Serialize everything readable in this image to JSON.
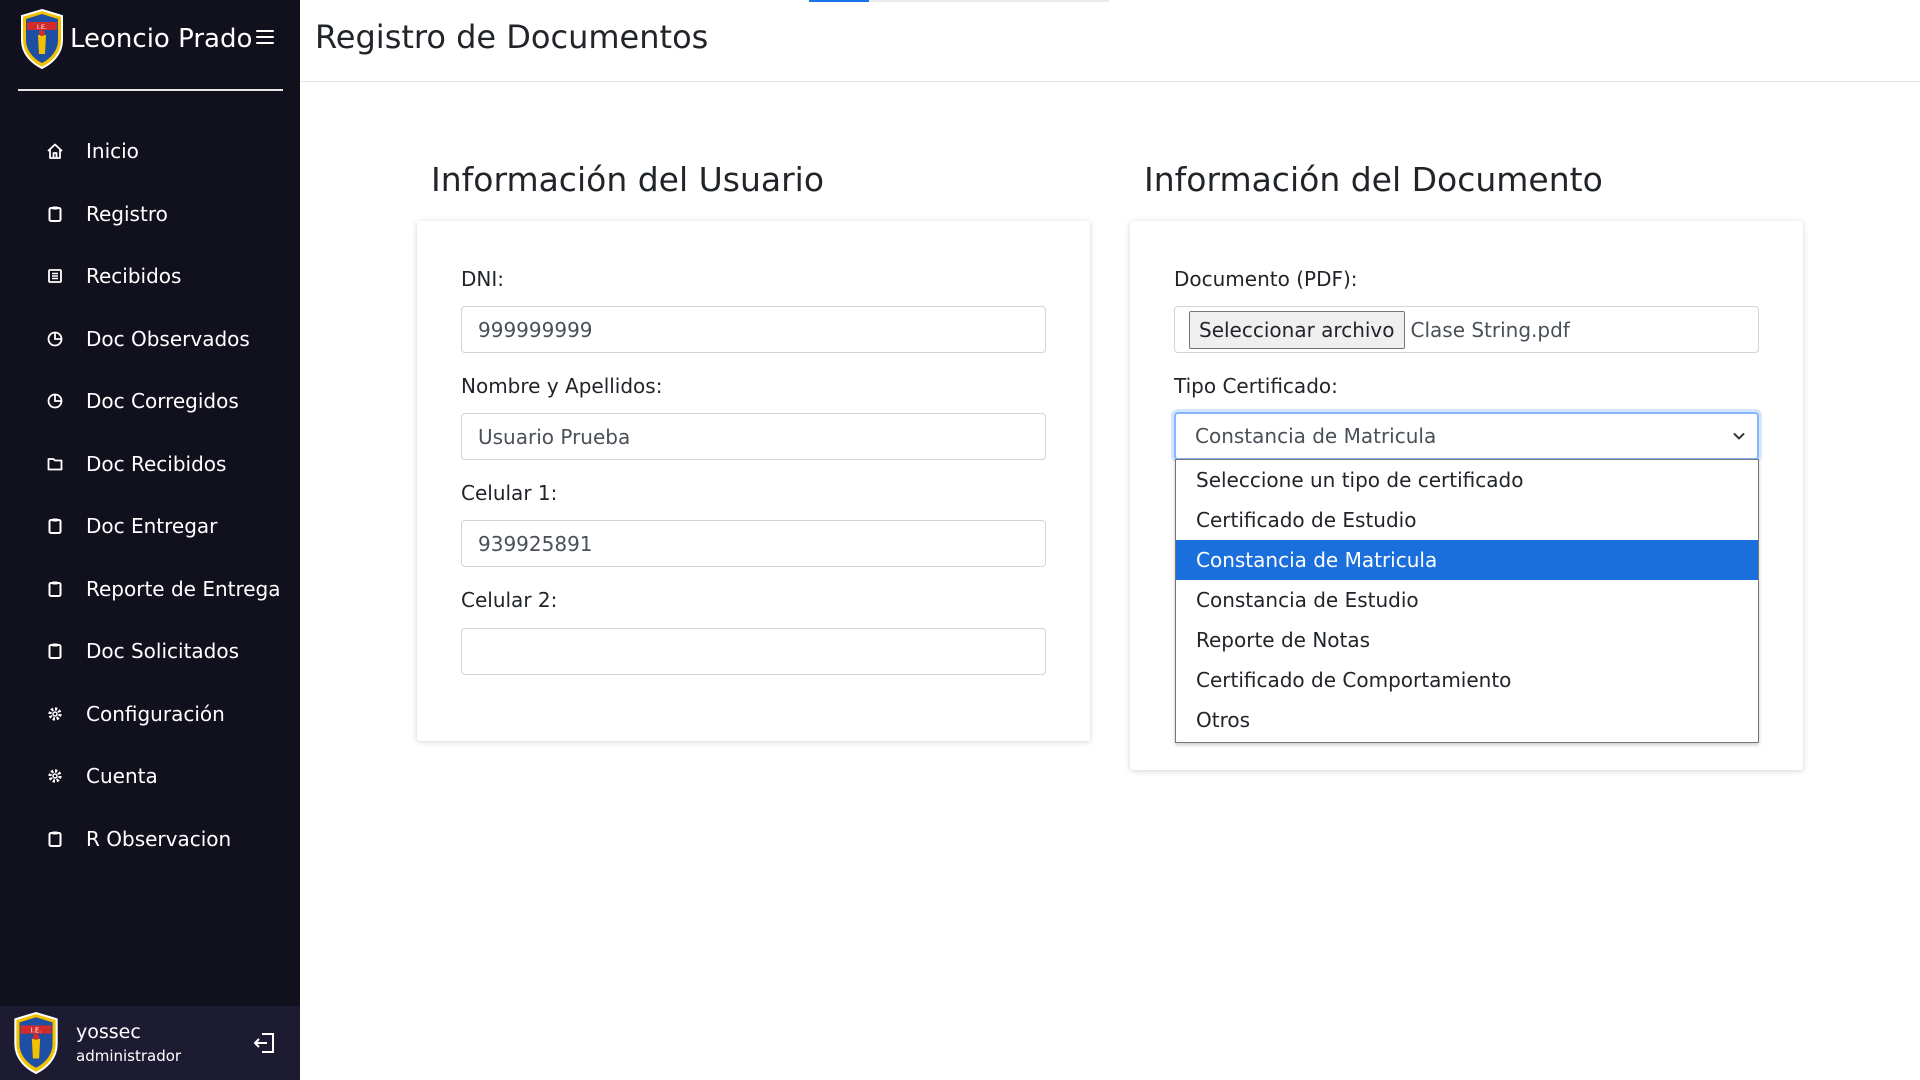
{
  "app": {
    "brand": "Leoncio Prado"
  },
  "sidebar": {
    "items": [
      {
        "label": "Inicio",
        "icon": "home-icon"
      },
      {
        "label": "Registro",
        "icon": "clipboard-icon"
      },
      {
        "label": "Recibidos",
        "icon": "list-icon"
      },
      {
        "label": "Doc Observados",
        "icon": "pie-chart-icon"
      },
      {
        "label": "Doc Corregidos",
        "icon": "pie-chart-icon"
      },
      {
        "label": "Doc Recibidos",
        "icon": "folder-icon"
      },
      {
        "label": "Doc Entregar",
        "icon": "clipboard-icon"
      },
      {
        "label": "Reporte de Entrega",
        "icon": "clipboard-icon"
      },
      {
        "label": "Doc Solicitados",
        "icon": "clipboard-icon"
      },
      {
        "label": "Configuración",
        "icon": "gear-icon"
      },
      {
        "label": "Cuenta",
        "icon": "gear-icon"
      },
      {
        "label": "R Observacion",
        "icon": "clipboard-icon"
      }
    ]
  },
  "profile": {
    "name": "yossec",
    "role": "administrador"
  },
  "header": {
    "title": "Registro de Documentos"
  },
  "top_progress": {
    "fraction": 0.2
  },
  "user_section": {
    "title": "Información del Usuario",
    "dni_label": "DNI:",
    "dni_value": "999999999",
    "name_label": "Nombre y Apellidos:",
    "name_value": "Usuario Prueba",
    "phone1_label": "Celular 1:",
    "phone1_value": "939925891",
    "phone2_label": "Celular 2:",
    "phone2_value": ""
  },
  "document_section": {
    "title": "Información del Documento",
    "file_label": "Documento (PDF):",
    "file_button": "Seleccionar archivo",
    "file_name": "Clase String.pdf",
    "type_label": "Tipo Certificado:",
    "type_selected": "Constancia de Matricula",
    "type_options": [
      "Seleccione un tipo de certificado",
      "Certificado de Estudio",
      "Constancia de Matricula",
      "Constancia de Estudio",
      "Reporte de Notas",
      "Certificado de Comportamiento",
      "Otros"
    ],
    "highlighted_index": 2
  },
  "colors": {
    "sidebar_bg": "#11101d",
    "profile_bg": "#1d1b31",
    "highlight": "#1a6fdc",
    "focus_border": "#86b7fe"
  }
}
